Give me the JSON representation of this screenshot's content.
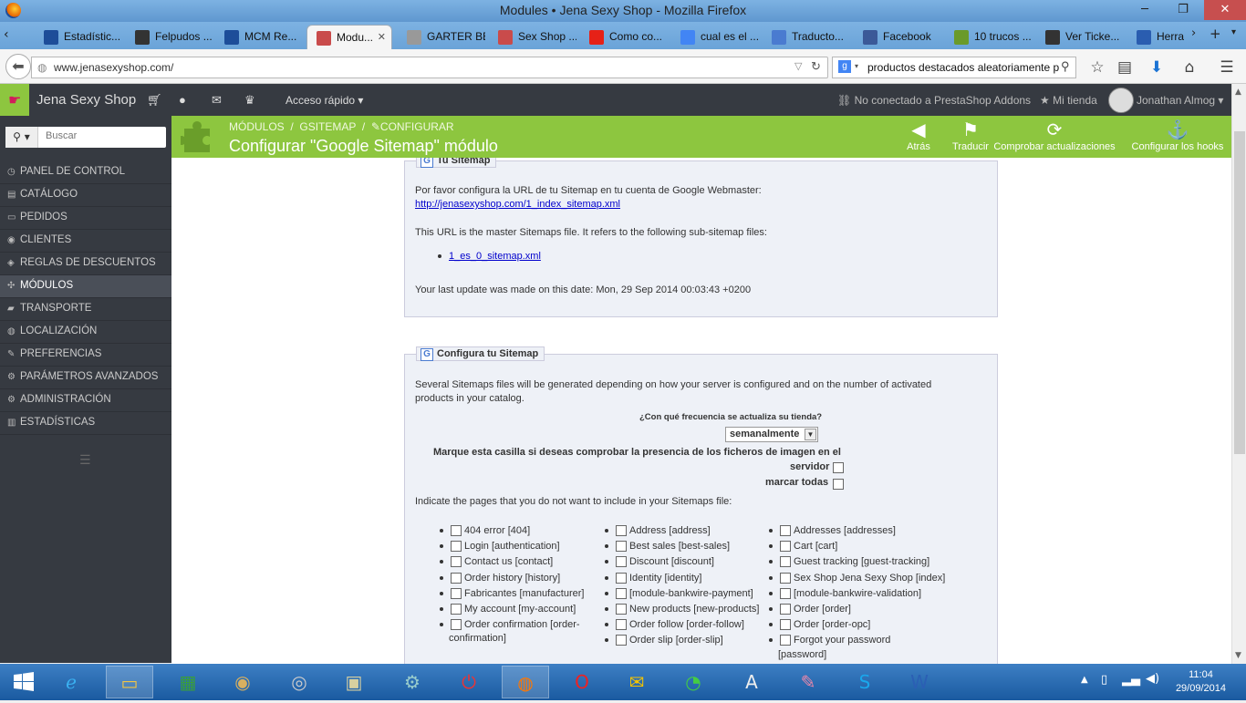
{
  "window": {
    "title": "Modules • Jena Sexy Shop - Mozilla Firefox"
  },
  "tabs": [
    {
      "label": "Estadístic...",
      "color": "#1d4d99"
    },
    {
      "label": "Felpudos ...",
      "color": "#333333"
    },
    {
      "label": "MCM Re...",
      "color": "#1d4d99"
    },
    {
      "label": "Modu...",
      "color": "#c94b4b"
    },
    {
      "label": "GARTER BELT...",
      "color": "#999999"
    },
    {
      "label": "Sex Shop ...",
      "color": "#c94b4b"
    },
    {
      "label": "Como co...",
      "color": "#e62117"
    },
    {
      "label": "cual es el ...",
      "color": "#4285f4"
    },
    {
      "label": "Traducto...",
      "color": "#4a7bd0"
    },
    {
      "label": "Facebook",
      "color": "#3b5998"
    },
    {
      "label": "10 trucos ...",
      "color": "#6a9a2a"
    },
    {
      "label": "Ver Ticke...",
      "color": "#333333"
    },
    {
      "label": "Herran",
      "color": "#2a5db0"
    }
  ],
  "nav": {
    "url": "www.jenasexyshop.com/",
    "search": "productos destacados aleatoriamente p"
  },
  "psheader": {
    "shop_name": "Jena Sexy Shop",
    "quick_access": "Acceso rápido ▾",
    "addons": "No conectado a PrestaShop Addons",
    "my_shop": "Mi tienda",
    "user": "Jonathan Almog ▾"
  },
  "sidebar": {
    "search_placeholder": "Buscar",
    "items": [
      {
        "label": "PANEL DE CONTROL",
        "icon": "dashboard-icon",
        "glyph": "◷"
      },
      {
        "label": "CATÁLOGO",
        "icon": "book-icon",
        "glyph": "▤"
      },
      {
        "label": "PEDIDOS",
        "icon": "credit-card-icon",
        "glyph": "▭"
      },
      {
        "label": "CLIENTES",
        "icon": "group-icon",
        "glyph": "◉"
      },
      {
        "label": "REGLAS DE DESCUENTOS",
        "icon": "tags-icon",
        "glyph": "◈"
      },
      {
        "label": "MÓDULOS",
        "icon": "puzzle-icon",
        "glyph": "✣"
      },
      {
        "label": "TRANSPORTE",
        "icon": "truck-icon",
        "glyph": "▰"
      },
      {
        "label": "LOCALIZACIÓN",
        "icon": "globe-icon",
        "glyph": "◍"
      },
      {
        "label": "PREFERENCIAS",
        "icon": "wrench-icon",
        "glyph": "✎"
      },
      {
        "label": "PARÁMETROS AVANZADOS",
        "icon": "cogs-icon",
        "glyph": "⚙"
      },
      {
        "label": "ADMINISTRACIÓN",
        "icon": "cog-icon",
        "glyph": "⚙"
      },
      {
        "label": "ESTADÍSTICAS",
        "icon": "bar-chart-icon",
        "glyph": "▥"
      }
    ]
  },
  "pagehead": {
    "breadcrumb": [
      "MÓDULOS",
      "/",
      "GSITEMAP",
      "/",
      "CONFIGURAR"
    ],
    "title": "Configurar \"Google Sitemap\" módulo",
    "toolbar": [
      {
        "label": "Atrás",
        "glyph": "◀"
      },
      {
        "label": "Traducir",
        "glyph": "⚑"
      },
      {
        "label": "Comprobar actualizaciones",
        "glyph": "⟳"
      },
      {
        "label": "Configurar los hooks",
        "glyph": "⚓"
      }
    ]
  },
  "sitemap_panel": {
    "legend": "Tu Sitemap",
    "intro": "Por favor configura la URL de tu Sitemap en tu cuenta de Google Webmaster:",
    "main_link": "http://jenasexyshop.com/1_index_sitemap.xml",
    "master_text": "This URL is the master Sitemaps file. It refers to the following sub-sitemap files:",
    "sub_link": "1_es_0_sitemap.xml",
    "last_update": "Your last update was made on this date: Mon, 29 Sep 2014 00:03:43 +0200"
  },
  "config_panel": {
    "legend": "Configura tu Sitemap",
    "intro_1": "Several Sitemaps files will be generated depending on how your server is configured and on the number of activated",
    "intro_2": "products in your catalog.",
    "frequency_label": "¿Con qué frecuencia se actualiza su tienda?",
    "frequency_value": "semanalmente",
    "images_label_1": "Marque esta casilla si deseas comprobar la presencia de los ficheros de imagen en el",
    "images_label_2": "servidor",
    "check_all": "marcar todas",
    "pages_label": "Indicate the pages that you do not want to include in your Sitemaps file:",
    "pages_col1": [
      "404 error [404]",
      "Login [authentication]",
      "Contact us [contact]",
      "Order history [history]",
      "Fabricantes [manufacturer]",
      "My account [my-account]",
      "Order confirmation [order-",
      "confirmation]"
    ],
    "pages_col2": [
      "Address [address]",
      "Best sales [best-sales]",
      "Discount [discount]",
      "Identity [identity]",
      "[module-bankwire-payment]",
      "New products [new-products]",
      "Order follow [order-follow]",
      "Order slip [order-slip]"
    ],
    "pages_col3": [
      "Addresses [addresses]",
      "Cart [cart]",
      "Guest tracking [guest-tracking]",
      "Sex Shop Jena Sexy Shop [index]",
      "[module-bankwire-validation]",
      "Order [order]",
      "Order [order-opc]",
      "Forgot your password",
      "[password]"
    ]
  },
  "taskbar": {
    "time": "11:04",
    "date": "29/09/2014"
  }
}
